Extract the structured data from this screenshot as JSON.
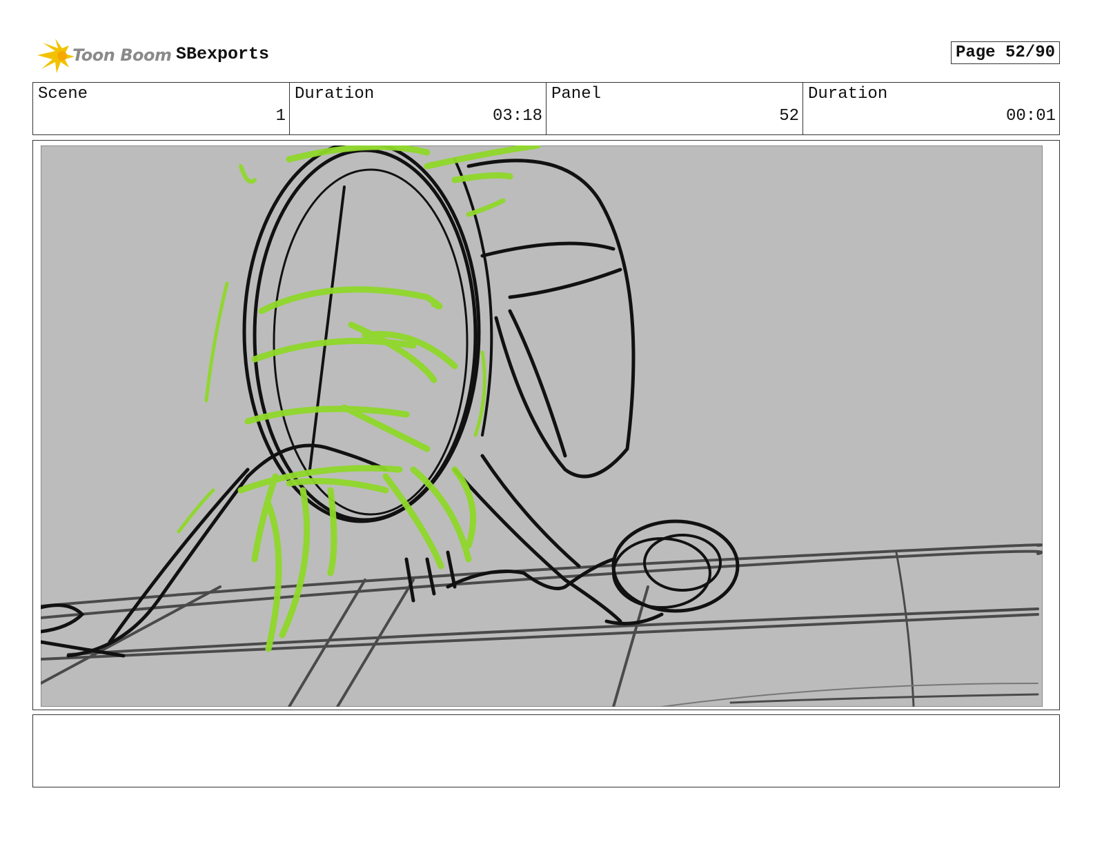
{
  "header": {
    "logo_text": "Toon Boom",
    "project_title": "SBexports",
    "page_label": "Page 52/90"
  },
  "info": {
    "scene_label": "Scene",
    "scene_value": "1",
    "scene_duration_label": "Duration",
    "scene_duration_value": "03:18",
    "panel_label": "Panel",
    "panel_value": "52",
    "panel_duration_label": "Duration",
    "panel_duration_value": "00:01"
  },
  "colors": {
    "sketch_background": "#bcbcbc",
    "ink": "#111111",
    "highlight": "#8fd82a",
    "logo_flame": "#f2c200"
  },
  "notes": {
    "text": ""
  }
}
